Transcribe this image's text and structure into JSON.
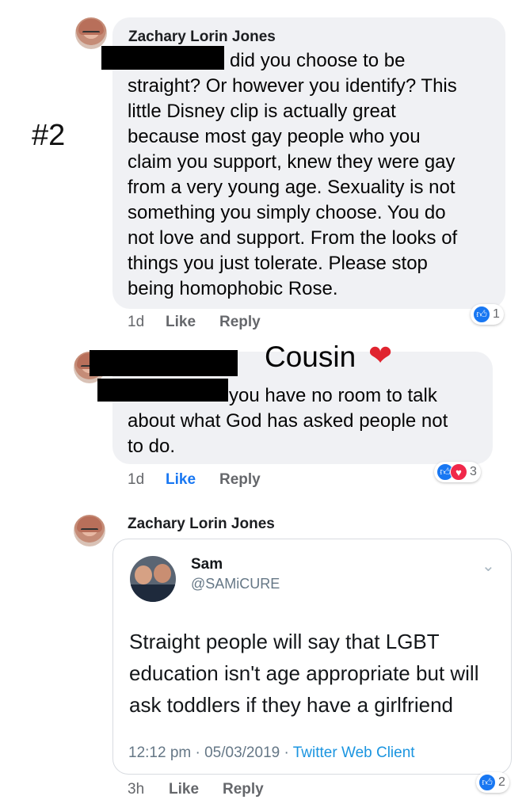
{
  "annotation": "#2",
  "comments": [
    {
      "author": "Zachary Lorin Jones",
      "text_lines": [
        "did you choose to be",
        "straight? Or however you identify? This",
        "little Disney clip is actually great",
        "because most gay people who you",
        "claim you support, knew they were gay",
        "from a very young age. Sexuality is not",
        "something you simply choose. You do",
        "not love and support. From the looks of",
        "things you just tolerate. Please stop",
        "being homophobic Rose."
      ],
      "time": "1d",
      "like_label": "Like",
      "reply_label": "Reply",
      "reactions": [
        "like"
      ],
      "reaction_count": "1"
    },
    {
      "overlay_label": "Cousin",
      "overlay_icon": "red-heart-icon",
      "text_lines": [
        "you have no room to talk",
        "about what God has asked people not",
        "to do."
      ],
      "time": "1d",
      "like_label": "Like",
      "reply_label": "Reply",
      "reactions": [
        "like",
        "love"
      ],
      "reaction_count": "3"
    },
    {
      "author": "Zachary Lorin Jones",
      "tweet": {
        "name": "Sam",
        "handle": "@SAMiCURE",
        "text_lines": [
          "Straight people will say that LGBT",
          "education isn't age appropriate but will",
          "ask toddlers if they have a girlfriend"
        ],
        "meta": "12:12 pm · 05/03/2019 · ",
        "client": "Twitter Web Client"
      },
      "time": "3h",
      "like_label": "Like",
      "reply_label": "Reply",
      "reactions": [
        "like"
      ],
      "reaction_count": "2"
    }
  ],
  "colors": {
    "like_blue": "#1877f2",
    "love_red": "#f0284a",
    "bubble": "#f0f1f4"
  }
}
